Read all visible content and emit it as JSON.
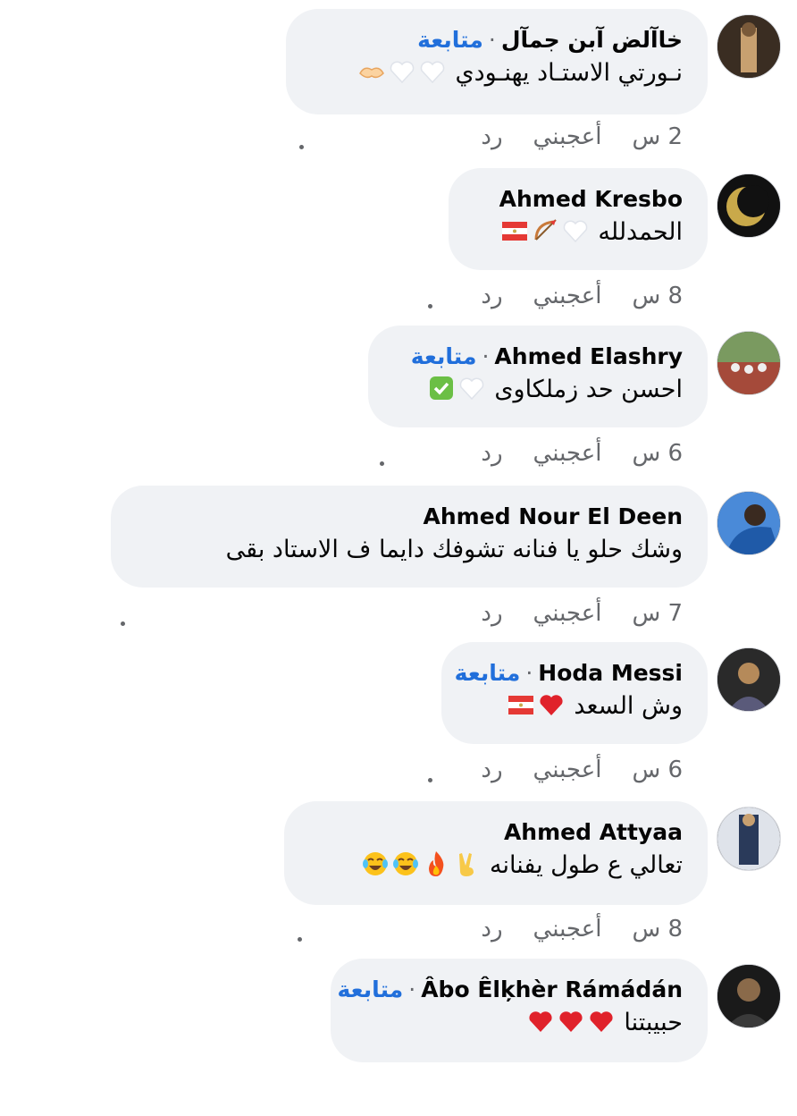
{
  "labels": {
    "follow": "متابعة",
    "like": "أعجبني",
    "reply": "رد",
    "separator": "·"
  },
  "comments": [
    {
      "author": "خاآلض آبن جمآل",
      "following": true,
      "text": "نـورتي الاستـاد يهنـودي",
      "emojis": [
        "white-heart",
        "white-heart",
        "handshake"
      ],
      "time": "2 س"
    },
    {
      "author": "Ahmed Kresbo",
      "following": false,
      "text": "الحمدلله",
      "emojis": [
        "white-heart",
        "bow-arrow",
        "flag-egypt"
      ],
      "time": "8 س"
    },
    {
      "author": "Ahmed Elashry",
      "following": true,
      "text": "احسن حد زملكاوى",
      "emojis": [
        "white-heart",
        "check-mark"
      ],
      "time": "6 س"
    },
    {
      "author": "Ahmed Nour El Deen",
      "following": false,
      "text": "وشك حلو يا فنانه تشوفك دايما ف الاستاد بقى",
      "emojis": [],
      "time": "7 س"
    },
    {
      "author": "Hoda Messi",
      "following": true,
      "text": "وش السعد",
      "emojis": [
        "red-heart",
        "flag-egypt"
      ],
      "time": "6 س"
    },
    {
      "author": "Ahmed Attyaa",
      "following": false,
      "text": "تعالي ع طول يفنانه",
      "emojis": [
        "victory-hand",
        "fire",
        "tears-of-joy",
        "tears-of-joy"
      ],
      "time": "8 س"
    },
    {
      "author": "Âbo Êlķhèr Rámádán",
      "following": true,
      "text": "حبيبتنا",
      "emojis": [
        "red-heart",
        "red-heart",
        "red-heart"
      ],
      "time": ""
    }
  ]
}
